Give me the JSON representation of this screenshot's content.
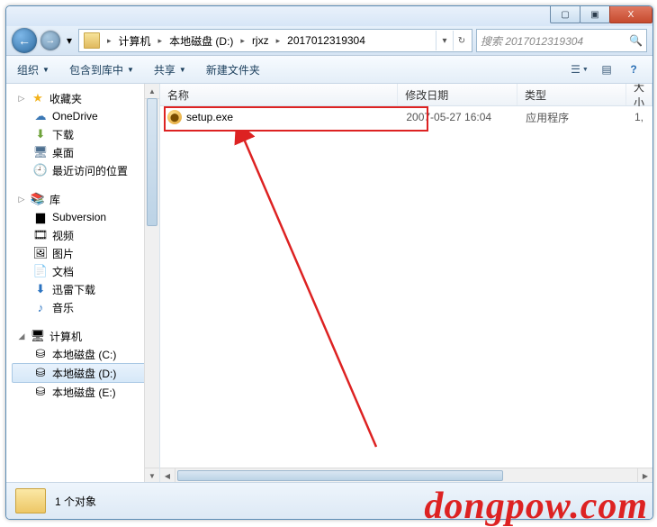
{
  "window_controls": {
    "min": "▢",
    "max": "▣",
    "close": "X"
  },
  "nav": {
    "back": "←",
    "fwd": "→",
    "drop": "▾"
  },
  "breadcrumb": {
    "items": [
      "计算机",
      "本地磁盘 (D:)",
      "rjxz",
      "2017012319304"
    ],
    "sep": "▸",
    "refresh": "↻",
    "dd": "▾"
  },
  "search": {
    "placeholder": "搜索 2017012319304",
    "icon": "🔍"
  },
  "toolbar": {
    "organize": "组织",
    "include": "包含到库中",
    "share": "共享",
    "newfolder": "新建文件夹",
    "dd": "▼",
    "view_icon": "☰",
    "preview_icon": "▤",
    "help_icon": "?"
  },
  "sidebar": {
    "favorites": {
      "label": "收藏夹",
      "icon": "★",
      "color": "#f3b21b"
    },
    "fav_items": [
      {
        "label": "OneDrive",
        "icon": "☁",
        "color": "#3b78b5"
      },
      {
        "label": "下载",
        "icon": "⬇",
        "color": "#6ea23a"
      },
      {
        "label": "桌面",
        "icon": "🖥",
        "color": "#4d6f8f"
      },
      {
        "label": "最近访问的位置",
        "icon": "🕘",
        "color": "#4d6f8f"
      }
    ],
    "libraries": {
      "label": "库",
      "icon": "📚",
      "color": "#4d6f8f"
    },
    "lib_items": [
      {
        "label": "Subversion",
        "icon": "▆",
        "color": "#4d6f8f"
      },
      {
        "label": "视频",
        "icon": "🎞",
        "color": "#4d6f8f"
      },
      {
        "label": "图片",
        "icon": "🖼",
        "color": "#4d6f8f"
      },
      {
        "label": "文档",
        "icon": "📄",
        "color": "#4d6f8f"
      },
      {
        "label": "迅雷下载",
        "icon": "⬇",
        "color": "#2a72c0"
      },
      {
        "label": "音乐",
        "icon": "♪",
        "color": "#2a72c0"
      }
    ],
    "computer": {
      "label": "计算机",
      "icon": "🖥",
      "color": "#4d6f8f"
    },
    "drives": [
      {
        "label": "本地磁盘 (C:)",
        "icon": "⛁",
        "sel": false
      },
      {
        "label": "本地磁盘 (D:)",
        "icon": "⛁",
        "sel": true
      },
      {
        "label": "本地磁盘 (E:)",
        "icon": "⛁",
        "sel": false
      }
    ],
    "exp_closed": "▷",
    "exp_open": "◢"
  },
  "columns": {
    "name": "名称",
    "date": "修改日期",
    "type": "类型",
    "size": "大小"
  },
  "files": [
    {
      "name": "setup.exe",
      "date": "2007-05-27 16:04",
      "type": "应用程序",
      "size": "1,"
    }
  ],
  "status": {
    "text": "1 个对象"
  },
  "watermark": "dongpow.com"
}
